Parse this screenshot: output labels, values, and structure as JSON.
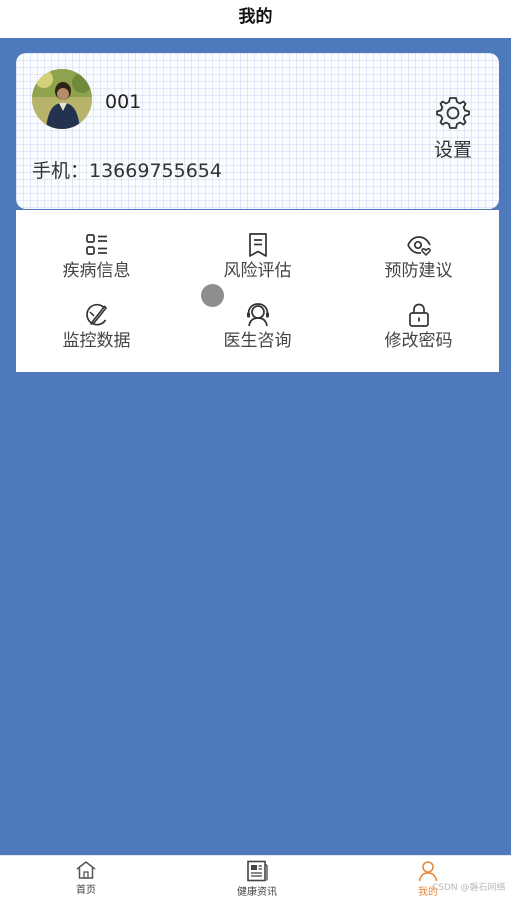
{
  "header": {
    "title": "我的"
  },
  "profile": {
    "username": "001",
    "phone": "手机：13669755654",
    "settings_label": "设置"
  },
  "menu": {
    "items": [
      {
        "label": "疾病信息",
        "icon": "list-icon"
      },
      {
        "label": "风险评估",
        "icon": "document-icon"
      },
      {
        "label": "预防建议",
        "icon": "eye-heart-icon"
      },
      {
        "label": "监控数据",
        "icon": "pen-chart-icon"
      },
      {
        "label": "医生咨询",
        "icon": "doctor-icon"
      },
      {
        "label": "修改密码",
        "icon": "lock-icon"
      }
    ]
  },
  "tabbar": {
    "tabs": [
      {
        "label": "首页",
        "icon": "home-icon",
        "active": false
      },
      {
        "label": "健康资讯",
        "icon": "news-icon",
        "active": false
      },
      {
        "label": "我的",
        "icon": "person-icon",
        "active": true
      }
    ]
  },
  "watermark": "CSDN @磐石网络",
  "colors": {
    "background": "#4f79bd",
    "active_tab": "#e58a3c",
    "card": "#ffffff"
  }
}
